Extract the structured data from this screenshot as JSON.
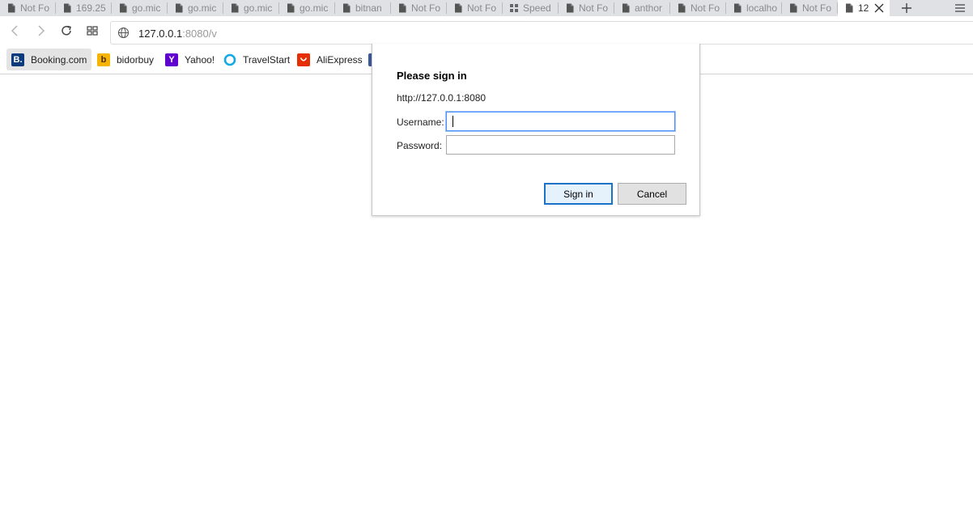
{
  "browser": {
    "tabs": [
      {
        "label": "Not Fo",
        "icon": "page-icon"
      },
      {
        "label": "169.25",
        "icon": "page-icon"
      },
      {
        "label": "go.mic",
        "icon": "page-icon"
      },
      {
        "label": "go.mic",
        "icon": "page-icon"
      },
      {
        "label": "go.mic",
        "icon": "page-icon"
      },
      {
        "label": "go.mic",
        "icon": "page-icon"
      },
      {
        "label": "bitnan",
        "icon": "page-icon"
      },
      {
        "label": "Not Fo",
        "icon": "page-icon"
      },
      {
        "label": "Not Fo",
        "icon": "page-icon"
      },
      {
        "label": "Speed",
        "icon": "speed-dial-icon"
      },
      {
        "label": "Not Fo",
        "icon": "page-icon"
      },
      {
        "label": "anthor",
        "icon": "page-icon"
      },
      {
        "label": "Not Fo",
        "icon": "page-icon"
      },
      {
        "label": "localho",
        "icon": "page-icon"
      },
      {
        "label": "Not Fo",
        "icon": "page-icon"
      },
      {
        "label": "12",
        "icon": "page-icon",
        "active": true
      }
    ],
    "address": {
      "host": "127.0.0.1",
      "rest": ":8080/v"
    },
    "bookmarks": [
      {
        "label": "Booking.com",
        "icon": "booking-icon",
        "glyph": "B.",
        "color": "#0c3b7c"
      },
      {
        "label": "bidorbuy",
        "icon": "bidorbuy-icon",
        "glyph": "b",
        "color": "#f5b400"
      },
      {
        "label": "Yahoo!",
        "icon": "yahoo-icon",
        "glyph": "Y",
        "color": "#5f01d1"
      },
      {
        "label": "TravelStart",
        "icon": "travelstart-icon",
        "glyph": "",
        "color": "#12a9e6"
      },
      {
        "label": "AliExpress",
        "icon": "aliexpress-icon",
        "glyph": "",
        "color": "#e62e04"
      }
    ]
  },
  "dialog": {
    "title": "Please sign in",
    "origin": "http://127.0.0.1:8080",
    "username_label": "Username:",
    "password_label": "Password:",
    "username_value": "",
    "password_value": "",
    "sign_in_label": "Sign in",
    "cancel_label": "Cancel"
  },
  "colors": {
    "tabstrip": "#dfe1e5",
    "focus_ring": "#4d90fe",
    "primary_button_border": "#1a73c6"
  }
}
